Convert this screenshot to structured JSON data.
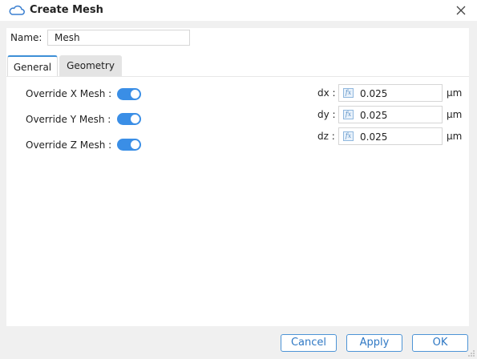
{
  "window": {
    "title": "Create Mesh",
    "icon": "cloud-icon",
    "close_icon": "close-icon"
  },
  "name_field": {
    "label": "Name:",
    "value": "Mesh"
  },
  "tabs": [
    {
      "label": "General",
      "active": true
    },
    {
      "label": "Geometry",
      "active": false
    }
  ],
  "overrides": [
    {
      "label": "Override X Mesh :",
      "on": true
    },
    {
      "label": "Override Y Mesh :",
      "on": true
    },
    {
      "label": "Override Z Mesh :",
      "on": true
    }
  ],
  "mesh_steps": [
    {
      "label": "dx :",
      "value": "0.025",
      "unit": "μm"
    },
    {
      "label": "dy :",
      "value": "0.025",
      "unit": "μm"
    },
    {
      "label": "dz :",
      "value": "0.025",
      "unit": "μm"
    }
  ],
  "fx_icon_text": "fx",
  "buttons": {
    "cancel": "Cancel",
    "apply": "Apply",
    "ok": "OK"
  },
  "colors": {
    "accent": "#3a8ee6",
    "button_border": "#4d94d6"
  }
}
